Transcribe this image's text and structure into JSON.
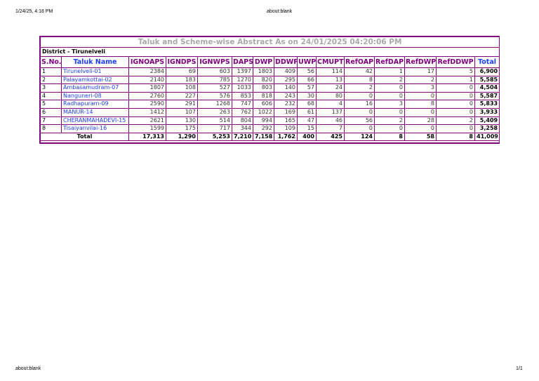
{
  "page_header": {
    "datetime": "1/24/25, 4:18 PM",
    "title": "about:blank"
  },
  "page_footer": {
    "url": "about:blank",
    "page": "1/1"
  },
  "report": {
    "title": "Taluk and Scheme-wise Abstract As on 24/01/2025 04:20:06 PM",
    "district": "District - Tirunelveli",
    "headers": [
      "S.No.",
      "Taluk Name",
      "IGNOAPS",
      "IGNDPS",
      "IGNWPS",
      "DAPS",
      "DWP",
      "DDWP",
      "UWP",
      "CMUPT",
      "RefOAP",
      "RefDAP",
      "RefDWP",
      "RefDDWP",
      "Total"
    ],
    "rows": [
      [
        "1",
        "Tirunelveli-01",
        "2384",
        "69",
        "603",
        "1397",
        "1803",
        "409",
        "56",
        "114",
        "42",
        "1",
        "17",
        "5",
        "6,900"
      ],
      [
        "2",
        "Palayamkottai-02",
        "2140",
        "183",
        "785",
        "1270",
        "820",
        "295",
        "66",
        "13",
        "8",
        "2",
        "2",
        "1",
        "5,585"
      ],
      [
        "3",
        "Ambasamudram-07",
        "1807",
        "108",
        "527",
        "1033",
        "803",
        "140",
        "57",
        "24",
        "2",
        "0",
        "3",
        "0",
        "4,504"
      ],
      [
        "4",
        "Nanguneri-08",
        "2760",
        "227",
        "576",
        "853",
        "818",
        "243",
        "30",
        "80",
        "0",
        "0",
        "0",
        "0",
        "5,587"
      ],
      [
        "5",
        "Radhapuram-09",
        "2590",
        "291",
        "1268",
        "747",
        "606",
        "232",
        "68",
        "4",
        "16",
        "3",
        "8",
        "0",
        "5,833"
      ],
      [
        "6",
        "MANUR-14",
        "1412",
        "107",
        "263",
        "762",
        "1022",
        "169",
        "61",
        "137",
        "0",
        "0",
        "0",
        "0",
        "3,933"
      ],
      [
        "7",
        "CHERANMAHADEVI-15",
        "2621",
        "130",
        "514",
        "804",
        "994",
        "165",
        "47",
        "46",
        "56",
        "2",
        "28",
        "2",
        "5,409"
      ],
      [
        "8",
        "Tisaiyanvilai-16",
        "1599",
        "175",
        "717",
        "344",
        "292",
        "109",
        "15",
        "7",
        "0",
        "0",
        "0",
        "0",
        "3,258"
      ]
    ],
    "total_row": [
      "Total",
      "17,313",
      "1,290",
      "5,253",
      "7,210",
      "7,158",
      "1,762",
      "400",
      "425",
      "124",
      "8",
      "58",
      "8",
      "41,009"
    ]
  }
}
